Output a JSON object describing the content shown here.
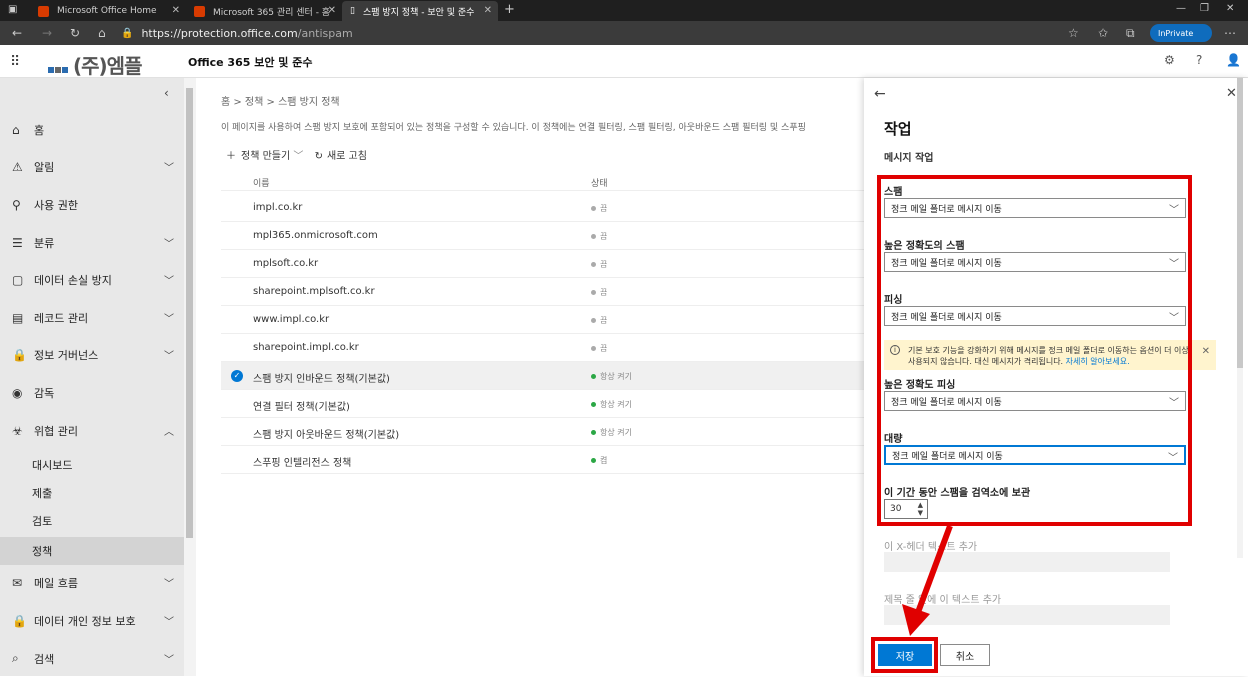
{
  "browser": {
    "tabs": [
      {
        "label": "Microsoft Office Home"
      },
      {
        "label": "Microsoft 365 관리 센터 - 홈"
      },
      {
        "label": "스팸 방지 정책 - 보안 및 준수"
      }
    ],
    "url_host": "https://protection.office.com",
    "url_path": "/antispam",
    "inprivate": "InPrivate"
  },
  "header": {
    "logo_text": "(주)엠플",
    "app_title": "Office 365 보안 및 준수"
  },
  "sidebar": {
    "items": [
      {
        "label": "홈"
      },
      {
        "label": "알림"
      },
      {
        "label": "사용 권한"
      },
      {
        "label": "분류"
      },
      {
        "label": "데이터 손실 방지"
      },
      {
        "label": "레코드 관리"
      },
      {
        "label": "정보 거버넌스"
      },
      {
        "label": "감독"
      },
      {
        "label": "위협 관리"
      },
      {
        "label": "대시보드"
      },
      {
        "label": "제출"
      },
      {
        "label": "검토"
      },
      {
        "label": "정책"
      },
      {
        "label": "메일 흐름"
      },
      {
        "label": "데이터 개인 정보 보호"
      },
      {
        "label": "검색"
      }
    ]
  },
  "main": {
    "breadcrumb": "홈  > 정책 >  스팸 방지 정책",
    "description": "이 페이지를 사용하여 스팸 방지 보호에 포함되어 있는 정책을 구성할 수 있습니다. 이 정책에는 연결 필터링, 스팸 필터링, 아웃바운드 스팸 필터링 및 스푸핑",
    "toolbar": {
      "create": "정책 만들기",
      "refresh": "새로 고침"
    },
    "columns": {
      "name": "이름",
      "status": "상태"
    },
    "rows": [
      {
        "name": "impl.co.kr",
        "status": "끔"
      },
      {
        "name": "mpl365.onmicrosoft.com",
        "status": "끔"
      },
      {
        "name": "mplsoft.co.kr",
        "status": "끔"
      },
      {
        "name": "sharepoint.mplsoft.co.kr",
        "status": "끔"
      },
      {
        "name": "www.impl.co.kr",
        "status": "끔"
      },
      {
        "name": "sharepoint.impl.co.kr",
        "status": "끔"
      },
      {
        "name": "스팸 방지 인바운드 정책(기본값)",
        "status": "항상 켜기"
      },
      {
        "name": "연결 필터 정책(기본값)",
        "status": "항상 켜기"
      },
      {
        "name": "스팸 방지 아웃바운드 정책(기본값)",
        "status": "항상 켜기"
      },
      {
        "name": "스푸핑 인텔리전스 정책",
        "status": "켬"
      }
    ]
  },
  "panel": {
    "title": "작업",
    "subtitle": "메시지 작업",
    "fields": [
      {
        "label": "스팸",
        "value": "정크 메일 폴더로 메시지 이동"
      },
      {
        "label": "높은 정확도의 스팸",
        "value": "정크 메일 폴더로 메시지 이동"
      },
      {
        "label": "피싱",
        "value": "정크 메일 폴더로 메시지 이동"
      },
      {
        "label": "높은 정확도 피싱",
        "value": "정크 메일 폴더로 메시지 이동"
      },
      {
        "label": "대량",
        "value": "정크 메일 폴더로 메시지 이동"
      }
    ],
    "warning_text": "기본 보호 기능을 강화하기 위해 메시지를 정크 메일 폴더로 이동하는 옵션이 더 이상 사용되지 않습니다. 대신 메시지가 격리됩니다.",
    "warning_link": "자세히 알아보세요.",
    "retention_label": "이 기간 동안 스팸을 검역소에 보관",
    "retention_value": "30",
    "xheader_label": "이 X-헤더 텍스트 추가",
    "subject_label": "제목 줄 앞에 이 텍스트 추가",
    "save": "저장",
    "cancel": "취소"
  },
  "colors": {
    "accent": "#0078d4",
    "annotation": "#e00000",
    "warning_bg": "#fff4ce"
  }
}
